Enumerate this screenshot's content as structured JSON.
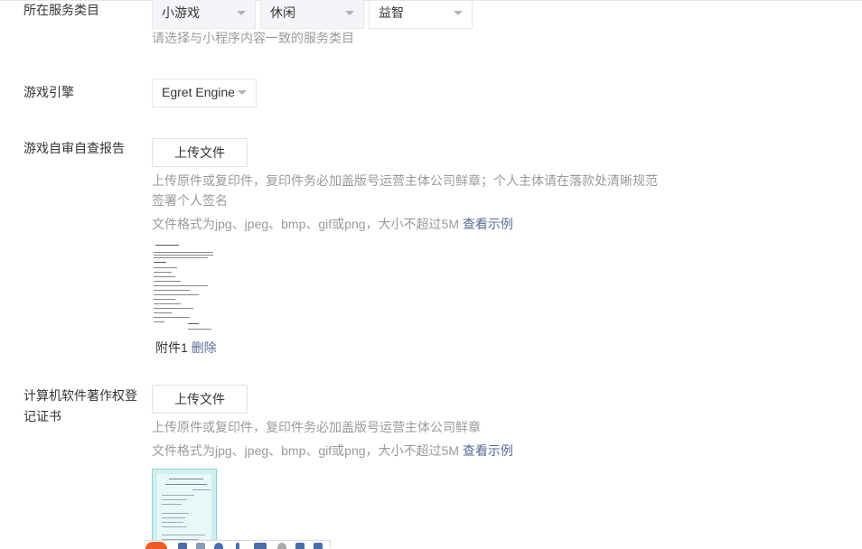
{
  "service_category": {
    "label": "所在服务类目",
    "selects": [
      {
        "value": "小游戏",
        "disabled": true
      },
      {
        "value": "休闲",
        "disabled": true
      },
      {
        "value": "益智",
        "disabled": false
      }
    ],
    "tip": "请选择与小程序内容一致的服务类目"
  },
  "game_engine": {
    "label": "游戏引擎",
    "value": "Egret Engine"
  },
  "self_check_report": {
    "label": "游戏自审自查报告",
    "upload_label": "上传文件",
    "tip_line1": "上传原件或复印件，复印件务必加盖版号运营主体公司鲜章；个人主体请在落款处清晰规范",
    "tip_line2": "签署个人签名",
    "format_tip": "文件格式为jpg、jpeg、bmp、gif或png，大小不超过5M",
    "example_link": "查看示例",
    "attachment_name": "附件1",
    "delete_label": "删除"
  },
  "software_copyright": {
    "label_line1": "计算机软件著作权登",
    "label_line2": "记证书",
    "upload_label": "上传文件",
    "tip": "上传原件或复印件，复印件务必加盖版号运营主体公司鲜章",
    "format_tip": "文件格式为jpg、jpeg、bmp、gif或png，大小不超过5M",
    "example_link": "查看示例"
  }
}
